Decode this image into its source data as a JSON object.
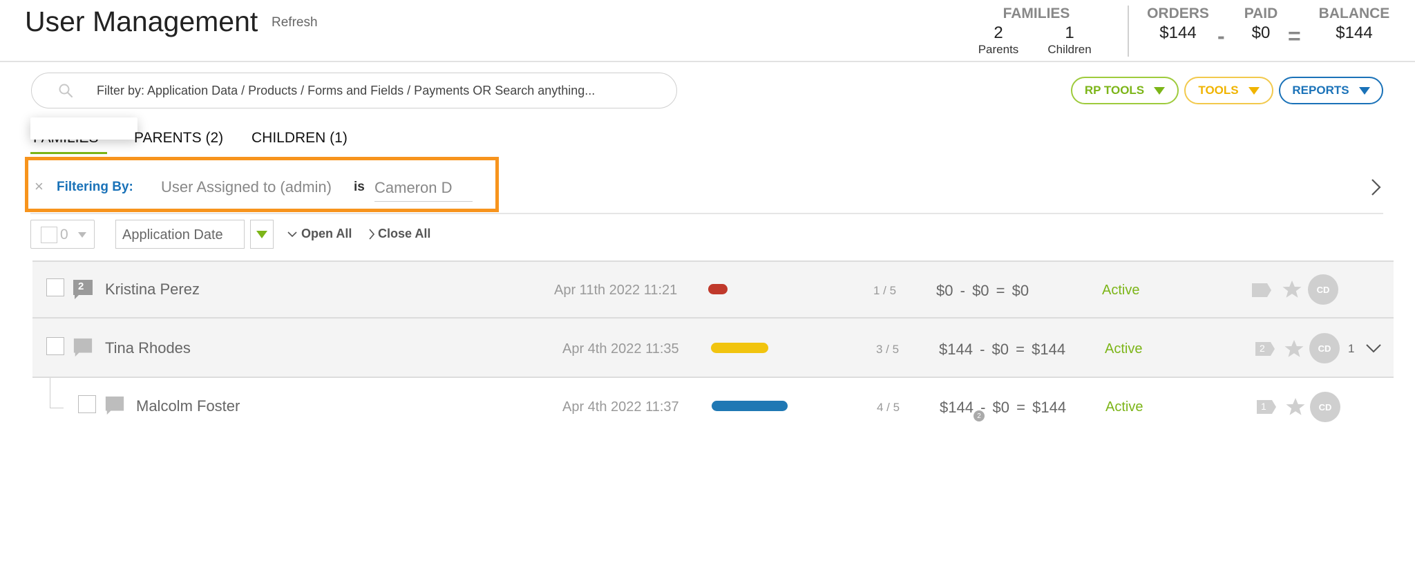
{
  "header": {
    "title": "User Management",
    "refresh_label": "Refresh",
    "stats": {
      "families_label": "FAMILIES",
      "parents_count": "2",
      "parents_label": "Parents",
      "children_count": "1",
      "children_label": "Children",
      "orders_label": "ORDERS",
      "orders_value": "$144",
      "minus": "-",
      "paid_label": "PAID",
      "paid_value": "$0",
      "equals": "=",
      "balance_label": "BALANCE",
      "balance_value": "$144"
    }
  },
  "search": {
    "placeholder": "Filter by: Application Data / Products / Forms and Fields / Payments OR Search anything..."
  },
  "tools": {
    "rp_tools": "RP TOOLS",
    "tools": "TOOLS",
    "reports": "REPORTS"
  },
  "tabs": {
    "families": "FAMILIES",
    "parents": "PARENTS (2)",
    "children": "CHILDREN (1)"
  },
  "filter": {
    "close": "×",
    "label": "Filtering By:",
    "field": "User Assigned to (admin)",
    "operator": "is",
    "value": "Cameron D"
  },
  "toolbar": {
    "selected_count": "0",
    "sort_field": "Application Date",
    "open_all": "Open All",
    "close_all": "Close All"
  },
  "rows": [
    {
      "name": "Kristina Perez",
      "chat_badge": "2",
      "date": "Apr 11th 2022 11:21",
      "progress": "1 / 5",
      "progress_color": "#c0392b",
      "orders": "$0",
      "minus": "-",
      "paid": "$0",
      "equals": "=",
      "balance": "$0",
      "status": "Active",
      "avatar": "CD"
    },
    {
      "name": "Tina Rhodes",
      "date": "Apr 4th 2022 11:35",
      "progress": "3 / 5",
      "progress_color": "#f1c40f",
      "orders": "$144",
      "minus": "-",
      "paid": "$0",
      "equals": "=",
      "balance": "$144",
      "status": "Active",
      "tag_badge": "2",
      "avatar": "CD",
      "children_count": "1"
    },
    {
      "name": "Malcolm Foster",
      "date": "Apr 4th 2022 11:37",
      "progress": "4 / 5",
      "progress_color": "#1f78b4",
      "orders": "$144",
      "orders_badge": "2",
      "minus": "-",
      "paid": "$0",
      "equals": "=",
      "balance": "$144",
      "status": "Active",
      "tag_badge": "1",
      "avatar": "CD"
    }
  ]
}
